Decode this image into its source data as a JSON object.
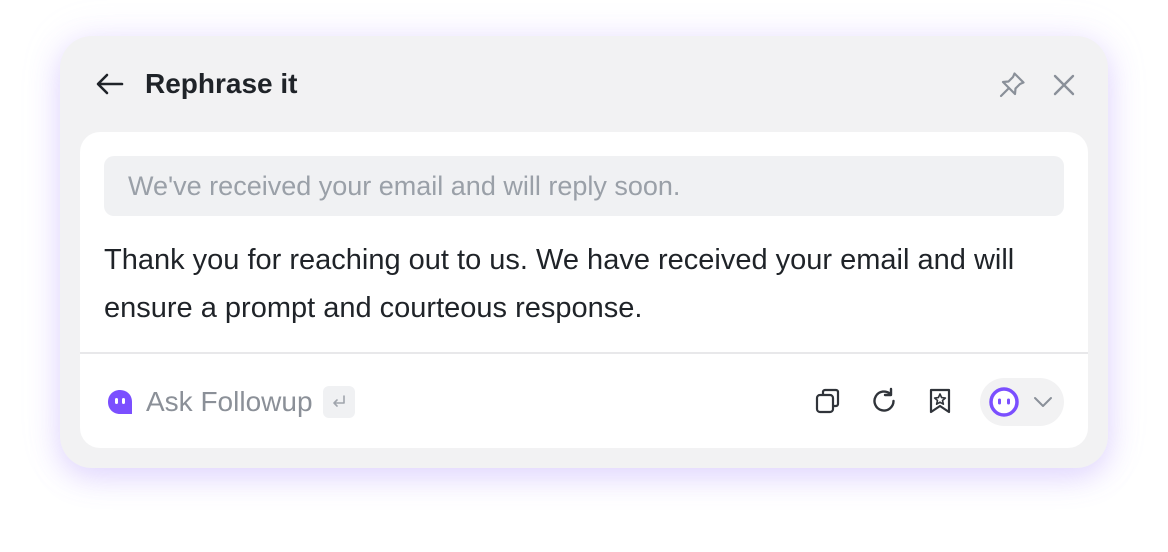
{
  "header": {
    "title": "Rephrase it",
    "icons": {
      "back": "arrow-left-icon",
      "pin": "pin-icon",
      "close": "close-icon"
    }
  },
  "content": {
    "original_text": "We've received your email and will reply soon.",
    "rephrased_text": "Thank you for reaching out to us. We have received your email and will ensure a prompt and courteous response."
  },
  "footer": {
    "followup_label": "Ask Followup",
    "enter_key_icon": "enter-key-icon",
    "actions": [
      "copy-icon",
      "regenerate-icon",
      "save-icon"
    ],
    "model_icon": "bot-avatar-icon",
    "model_dropdown_icon": "chevron-down-icon"
  },
  "colors": {
    "accent": "#7b4fff",
    "panel_bg": "#f2f2f3",
    "card_bg": "#ffffff",
    "title_text": "#1f2328",
    "muted_text": "#8b9098",
    "icon_gray": "#8a9099"
  }
}
